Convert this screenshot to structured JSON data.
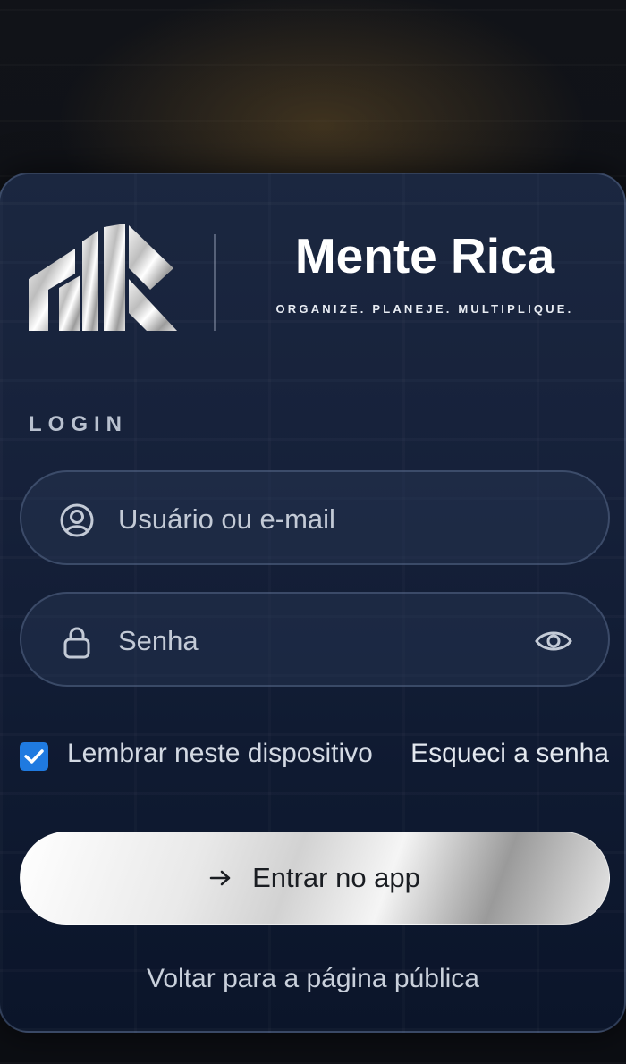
{
  "brand": {
    "logo_icon": "mr-monogram-icon",
    "title": "Mente Rica",
    "tagline": "ORGANIZE. PLANEJE. MULTIPLIQUE."
  },
  "login": {
    "section_label": "LOGIN",
    "username_field": {
      "icon": "user-circle-icon",
      "placeholder": "Usuário ou e-mail",
      "value": ""
    },
    "password_field": {
      "icon": "lock-icon",
      "placeholder": "Senha",
      "value": "",
      "toggle_icon": "eye-icon"
    },
    "remember": {
      "label": "Lembrar neste dispositivo",
      "checked": true
    },
    "forgot_label": "Esqueci a senha",
    "submit": {
      "icon": "arrow-right-icon",
      "label": "Entrar no app"
    },
    "back_label": "Voltar para a página pública"
  },
  "colors": {
    "checkbox": "#1f7ae0",
    "card_background": "#16213a",
    "title": "#ffffff"
  }
}
